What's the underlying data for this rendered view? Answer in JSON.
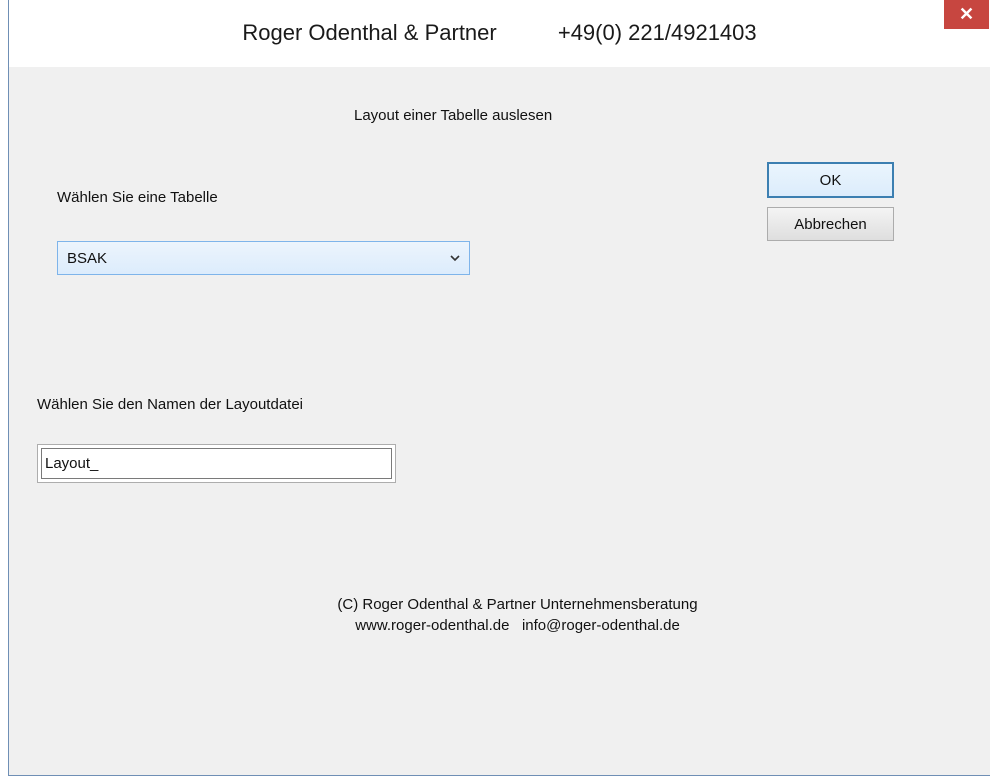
{
  "window": {
    "title": "Roger Odenthal & Partner          +49(0) 221/4921403",
    "close_label": "✕"
  },
  "dialog": {
    "heading": "Layout einer Tabelle auslesen",
    "table_label": "Wählen Sie eine Tabelle",
    "table_selected": "BSAK",
    "layout_label": "Wählen Sie den Namen der Layoutdatei",
    "layout_value": "Layout_",
    "ok_label": "OK",
    "cancel_label": "Abbrechen"
  },
  "footer": {
    "line1": "(C) Roger Odenthal & Partner Unternehmensberatung",
    "line2": "www.roger-odenthal.de   info@roger-odenthal.de"
  }
}
